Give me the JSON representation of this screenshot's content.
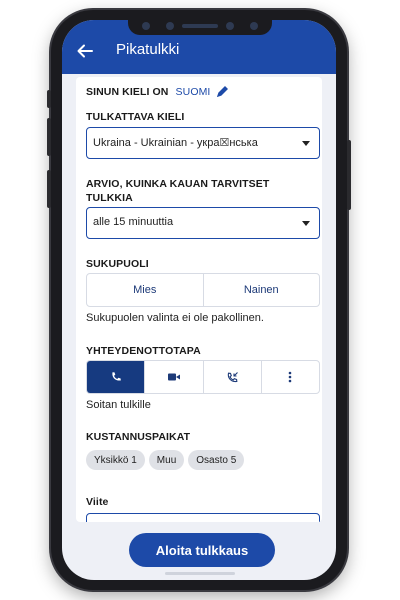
{
  "app_bar": {
    "title": "Pikatulkki"
  },
  "language": {
    "label": "SINUN KIELI ON",
    "value": "SUOMI"
  },
  "interpret_language": {
    "label": "TULKATTAVA KIELI",
    "value": "Ukraina - Ukrainian - укра☒нська"
  },
  "duration": {
    "label_line1": "ARVIO, KUINKA KAUAN TARVITSET",
    "label_line2": "TULKKIA",
    "value": "alle 15 minuuttia"
  },
  "gender": {
    "label": "SUKUPUOLI",
    "options": [
      "Mies",
      "Nainen"
    ],
    "helper": "Sukupuolen valinta ei ole pakollinen."
  },
  "contact": {
    "label": "YHTEYDENOTTOTAPA",
    "options": [
      "phone-icon",
      "video-icon",
      "callback-icon",
      "more-icon"
    ],
    "selected": 0,
    "helper": "Soitan tulkille"
  },
  "cost_centers": {
    "label": "KUSTANNUSPAIKAT",
    "chips": [
      "Yksikkö 1",
      "Muu",
      "Osasto 5"
    ]
  },
  "reference": {
    "label": "Viite"
  },
  "start_button": {
    "label": "Aloita tulkkaus"
  },
  "colors": {
    "primary": "#1d4aa8",
    "active": "#163a80",
    "background": "#eef0f6"
  }
}
